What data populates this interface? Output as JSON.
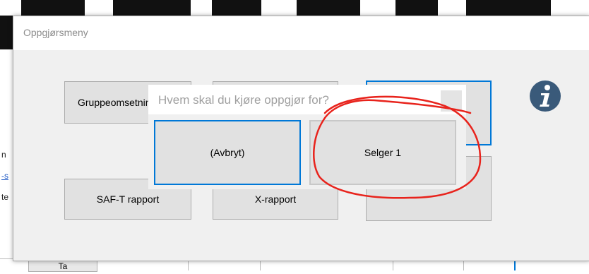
{
  "window": {
    "title": "Oppgjørsmeny"
  },
  "buttons": {
    "group_sales": "Gruppeomsetning",
    "saft_report": "SAF-T rapport",
    "x_report": "X-rapport"
  },
  "icons": {
    "info": "info-icon",
    "info_color": "#3a5a7a"
  },
  "dialog": {
    "title": "Hvem skal du kjøre oppgjør for?",
    "cancel_label": "(Avbryt)",
    "seller_label": "Selger 1"
  },
  "background": {
    "tab_label": "Ta",
    "left_lines": [
      "n",
      "-s",
      "te"
    ]
  },
  "colors": {
    "focus_border": "#0078d7",
    "annotation": "#e8231c",
    "button_face": "#e1e1e1",
    "window_bg": "#f0f0f0"
  }
}
